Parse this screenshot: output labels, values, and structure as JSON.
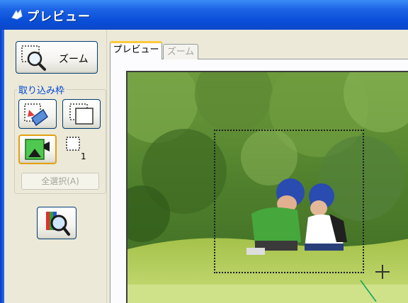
{
  "window": {
    "title": "プレビュー",
    "title_icon": "app-icon"
  },
  "toolbar": {
    "zoom_label": "ズーム",
    "frame_group_label": "取り込み枠",
    "frame_count": "1",
    "select_all_label": "全選択(A)"
  },
  "tabs": [
    {
      "label": "プレビュー",
      "active": true
    },
    {
      "label": "ズーム",
      "active": false
    }
  ],
  "colors": {
    "titlebar": "#0a4ed8",
    "panel": "#ece9d8",
    "accent_tab": "#ffc83c",
    "group_label": "#0046d5"
  },
  "icons": [
    "zoom-magnifier-icon",
    "auto-detect-icon",
    "copy-frame-icon",
    "target-type-icon",
    "frame-count-icon",
    "image-adjust-icon",
    "crosshair-icon"
  ]
}
